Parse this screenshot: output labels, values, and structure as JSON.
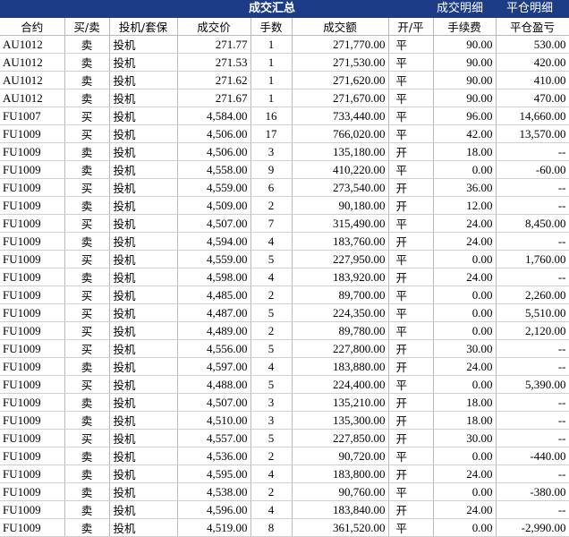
{
  "tabs": [
    {
      "label": "成交汇总"
    },
    {
      "label": "成交明细"
    },
    {
      "label": "平仓明细"
    }
  ],
  "columns": [
    "合约",
    "买/卖",
    "投机/套保",
    "成交价",
    "手数",
    "成交额",
    "开/平",
    "手续费",
    "平仓盈亏"
  ],
  "rows": [
    [
      "AU1012",
      "卖",
      "投机",
      "271.77",
      "1",
      "271,770.00",
      "平",
      "90.00",
      "530.00"
    ],
    [
      "AU1012",
      "卖",
      "投机",
      "271.53",
      "1",
      "271,530.00",
      "平",
      "90.00",
      "420.00"
    ],
    [
      "AU1012",
      "卖",
      "投机",
      "271.62",
      "1",
      "271,620.00",
      "平",
      "90.00",
      "410.00"
    ],
    [
      "AU1012",
      "卖",
      "投机",
      "271.67",
      "1",
      "271,670.00",
      "平",
      "90.00",
      "470.00"
    ],
    [
      "FU1007",
      "买",
      "投机",
      "4,584.00",
      "16",
      "733,440.00",
      "平",
      "96.00",
      "14,660.00"
    ],
    [
      "FU1009",
      "买",
      "投机",
      "4,506.00",
      "17",
      "766,020.00",
      "平",
      "42.00",
      "13,570.00"
    ],
    [
      "FU1009",
      "卖",
      "投机",
      "4,506.00",
      "3",
      "135,180.00",
      "开",
      "18.00",
      "--"
    ],
    [
      "FU1009",
      "卖",
      "投机",
      "4,558.00",
      "9",
      "410,220.00",
      "平",
      "0.00",
      "-60.00"
    ],
    [
      "FU1009",
      "买",
      "投机",
      "4,559.00",
      "6",
      "273,540.00",
      "开",
      "36.00",
      "--"
    ],
    [
      "FU1009",
      "卖",
      "投机",
      "4,509.00",
      "2",
      "90,180.00",
      "开",
      "12.00",
      "--"
    ],
    [
      "FU1009",
      "买",
      "投机",
      "4,507.00",
      "7",
      "315,490.00",
      "平",
      "24.00",
      "8,450.00"
    ],
    [
      "FU1009",
      "卖",
      "投机",
      "4,594.00",
      "4",
      "183,760.00",
      "开",
      "24.00",
      "--"
    ],
    [
      "FU1009",
      "买",
      "投机",
      "4,559.00",
      "5",
      "227,950.00",
      "平",
      "0.00",
      "1,760.00"
    ],
    [
      "FU1009",
      "卖",
      "投机",
      "4,598.00",
      "4",
      "183,920.00",
      "开",
      "24.00",
      "--"
    ],
    [
      "FU1009",
      "买",
      "投机",
      "4,485.00",
      "2",
      "89,700.00",
      "平",
      "0.00",
      "2,260.00"
    ],
    [
      "FU1009",
      "买",
      "投机",
      "4,487.00",
      "5",
      "224,350.00",
      "平",
      "0.00",
      "5,510.00"
    ],
    [
      "FU1009",
      "买",
      "投机",
      "4,489.00",
      "2",
      "89,780.00",
      "平",
      "0.00",
      "2,120.00"
    ],
    [
      "FU1009",
      "买",
      "投机",
      "4,556.00",
      "5",
      "227,800.00",
      "开",
      "30.00",
      "--"
    ],
    [
      "FU1009",
      "卖",
      "投机",
      "4,597.00",
      "4",
      "183,880.00",
      "开",
      "24.00",
      "--"
    ],
    [
      "FU1009",
      "买",
      "投机",
      "4,488.00",
      "5",
      "224,400.00",
      "平",
      "0.00",
      "5,390.00"
    ],
    [
      "FU1009",
      "卖",
      "投机",
      "4,507.00",
      "3",
      "135,210.00",
      "开",
      "18.00",
      "--"
    ],
    [
      "FU1009",
      "卖",
      "投机",
      "4,510.00",
      "3",
      "135,300.00",
      "开",
      "18.00",
      "--"
    ],
    [
      "FU1009",
      "买",
      "投机",
      "4,557.00",
      "5",
      "227,850.00",
      "开",
      "30.00",
      "--"
    ],
    [
      "FU1009",
      "卖",
      "投机",
      "4,536.00",
      "2",
      "90,720.00",
      "平",
      "0.00",
      "-440.00"
    ],
    [
      "FU1009",
      "卖",
      "投机",
      "4,595.00",
      "4",
      "183,800.00",
      "开",
      "24.00",
      "--"
    ],
    [
      "FU1009",
      "卖",
      "投机",
      "4,538.00",
      "2",
      "90,760.00",
      "平",
      "0.00",
      "-380.00"
    ],
    [
      "FU1009",
      "卖",
      "投机",
      "4,596.00",
      "4",
      "183,840.00",
      "开",
      "24.00",
      "--"
    ],
    [
      "FU1009",
      "卖",
      "投机",
      "4,519.00",
      "8",
      "361,520.00",
      "平",
      "0.00",
      "-2,990.00"
    ]
  ]
}
